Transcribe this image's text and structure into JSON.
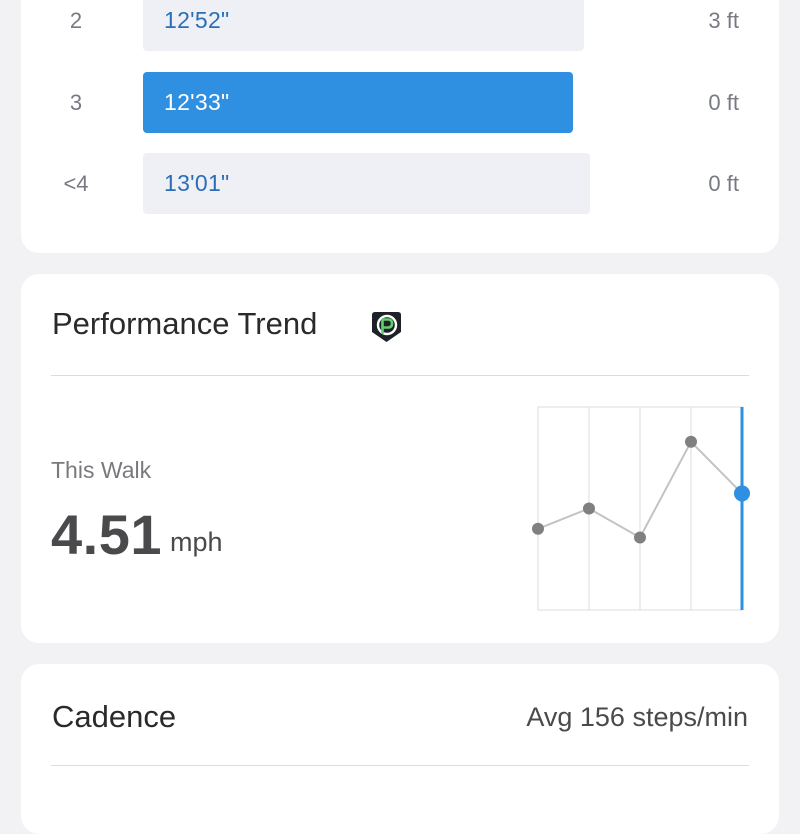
{
  "splits": [
    {
      "number": "2",
      "pace": "12'52\"",
      "elevation": "3 ft",
      "active": false
    },
    {
      "number": "3",
      "pace": "12'33\"",
      "elevation": "0 ft",
      "active": true
    },
    {
      "number": "<4",
      "pace": "13'01\"",
      "elevation": "0 ft",
      "active": false
    }
  ],
  "performance": {
    "title": "Performance Trend",
    "badge_icon": "premium-p-badge-icon",
    "this_walk_label": "This Walk",
    "speed_value": "4.51",
    "speed_unit": "mph",
    "trend_values": [
      3.9,
      4.25,
      3.75,
      5.4,
      4.51
    ],
    "trend_range": [
      2.5,
      6.0
    ],
    "current_index": 4
  },
  "cadence": {
    "title": "Cadence",
    "average": "Avg 156 steps/min"
  },
  "colors": {
    "accent": "#2f8fe0",
    "bar_inactive": "#eef0f6",
    "pace_text": "#2a6fb6",
    "trend_point": "#808080",
    "trend_line": "#c3c3c3"
  }
}
